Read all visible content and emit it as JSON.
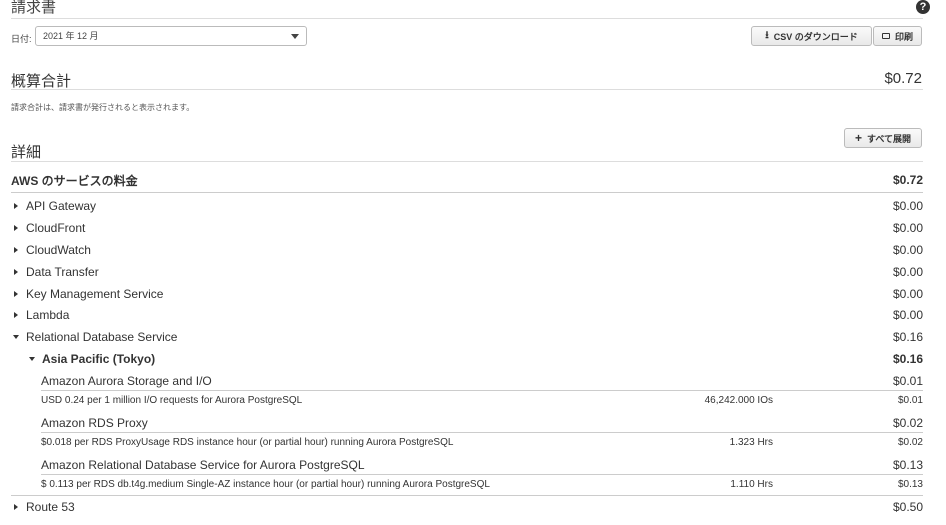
{
  "header": {
    "title": "請求書",
    "help_icon": "?"
  },
  "date": {
    "label": "日付:",
    "value": "2021 年 12 月"
  },
  "buttons": {
    "csv": "CSV のダウンロード",
    "print": "印刷",
    "expand_all": "すべて展開"
  },
  "total": {
    "label": "概算合計",
    "value": "$0.72",
    "note": "請求合計は、請求書が発行されると表示されます。"
  },
  "details": {
    "title": "詳細",
    "group_label": "AWS のサービスの料金",
    "group_total": "$0.72",
    "services": [
      {
        "name": "API Gateway",
        "amount": "$0.00"
      },
      {
        "name": "CloudFront",
        "amount": "$0.00"
      },
      {
        "name": "CloudWatch",
        "amount": "$0.00"
      },
      {
        "name": "Data Transfer",
        "amount": "$0.00"
      },
      {
        "name": "Key Management Service",
        "amount": "$0.00"
      },
      {
        "name": "Lambda",
        "amount": "$0.00"
      },
      {
        "name": "Relational Database Service",
        "amount": "$0.16"
      },
      {
        "name": "Route 53",
        "amount": "$0.50"
      }
    ],
    "region": {
      "name": "Asia Pacific (Tokyo)",
      "amount": "$0.16"
    },
    "items": [
      {
        "title": "Amazon Aurora Storage and I/O",
        "title_amount": "$0.01",
        "desc": "USD 0.24 per 1 million I/O requests for Aurora PostgreSQL",
        "qty": "46,242.000 IOs",
        "amount": "$0.01"
      },
      {
        "title": "Amazon RDS Proxy",
        "title_amount": "$0.02",
        "desc": "$0.018 per RDS ProxyUsage RDS instance hour (or partial hour) running Aurora PostgreSQL",
        "qty": "1.323 Hrs",
        "amount": "$0.02"
      },
      {
        "title": "Amazon Relational Database Service for Aurora PostgreSQL",
        "title_amount": "$0.13",
        "desc": "$ 0.113 per RDS db.t4g.medium Single-AZ instance hour (or partial hour) running Aurora PostgreSQL",
        "qty": "1.110 Hrs",
        "amount": "$0.13"
      }
    ]
  }
}
